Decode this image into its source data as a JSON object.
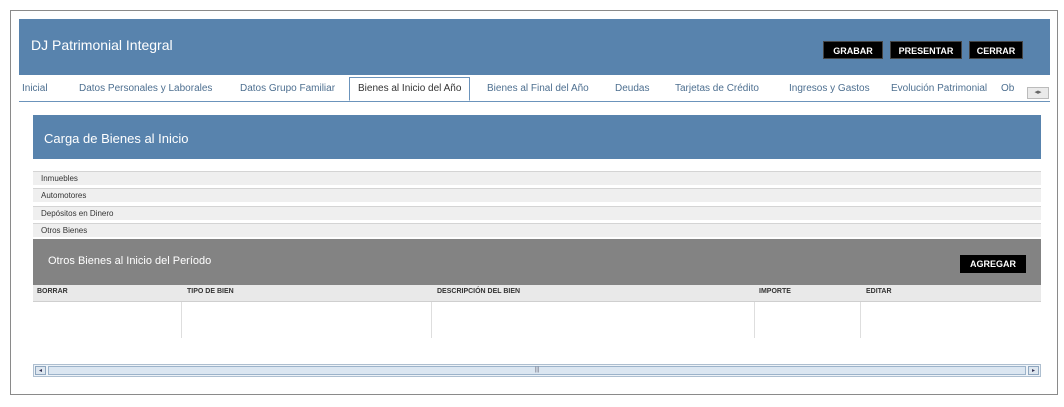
{
  "header": {
    "title": "DJ Patrimonial Integral",
    "buttons": {
      "save": "GRABAR",
      "submit": "PRESENTAR",
      "close": "CERRAR"
    }
  },
  "tabs": [
    {
      "label": "Inicial"
    },
    {
      "label": "Datos Personales y Laborales"
    },
    {
      "label": "Datos Grupo Familiar"
    },
    {
      "label": "Bienes al Inicio del Año",
      "active": true
    },
    {
      "label": "Bienes al Final del Año"
    },
    {
      "label": "Deudas"
    },
    {
      "label": "Tarjetas de Crédito"
    },
    {
      "label": "Ingresos y Gastos"
    },
    {
      "label": "Evolución Patrimonial"
    },
    {
      "label": "Ob"
    }
  ],
  "tab_scroll_icon": "left-right-arrows-icon",
  "section": {
    "title": "Carga de Bienes al Inicio"
  },
  "accordion": [
    {
      "label": "Inmuebles"
    },
    {
      "label": "Automotores"
    },
    {
      "label": "Depósitos en Dinero"
    },
    {
      "label": "Otros Bienes"
    }
  ],
  "panel": {
    "title": "Otros Bienes al Inicio del Período",
    "add_button": "AGREGAR"
  },
  "grid": {
    "columns": [
      "BORRAR",
      "TIPO DE BIEN",
      "DESCRIPCIÓN DEL BIEN",
      "IMPORTE",
      "EDITAR"
    ],
    "rows": []
  },
  "colors": {
    "header_blue": "#5883ad",
    "panel_gray": "#838383",
    "button_black": "#000000"
  }
}
